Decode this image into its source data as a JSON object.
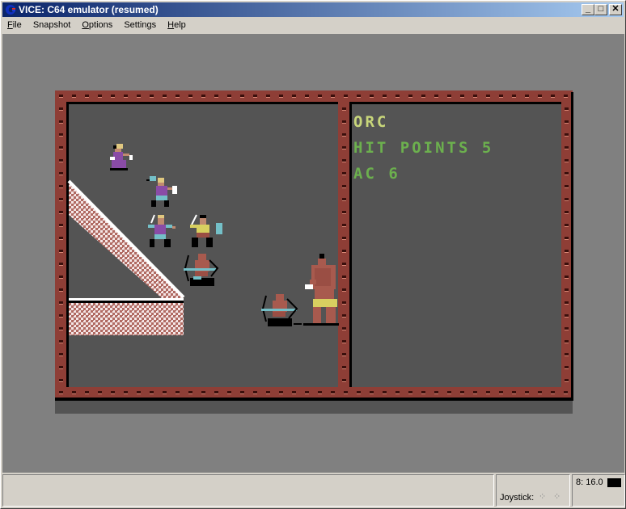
{
  "window": {
    "title": "VICE: C64 emulator (resumed)",
    "icon": "c64-app-icon",
    "controls": [
      {
        "name": "minimize",
        "glyph": "_"
      },
      {
        "name": "maximize",
        "glyph": "□"
      },
      {
        "name": "close",
        "glyph": "✕"
      }
    ]
  },
  "menubar": {
    "items": [
      {
        "label": "File",
        "accel": "F",
        "rest": "ile"
      },
      {
        "label": "Snapshot",
        "accel": "",
        "rest": "Snapshot"
      },
      {
        "label": "Options",
        "accel": "O",
        "rest": "ptions"
      },
      {
        "label": "Settings",
        "accel": "",
        "rest": "Settings"
      },
      {
        "label": "Help",
        "accel": "H",
        "rest": "elp"
      }
    ]
  },
  "game": {
    "info_panel": {
      "name": "ORC",
      "hit_points_label": "HIT POINTS",
      "hit_points_value": "5",
      "ac_label": "AC",
      "ac_value": "6"
    },
    "colors": {
      "screen_bg": "#545454",
      "border": "#8e3e36",
      "name_color": "#c8d67a",
      "stat_color": "#6cb04e",
      "wall_light": "#f4e6e6",
      "wall_dark": "#b06a62"
    },
    "party": [
      {
        "id": "cleric",
        "colors": [
          "#e0c880",
          "#8a4ca6",
          "#ffffff"
        ]
      },
      {
        "id": "fighter-with-flail",
        "colors": [
          "#e0c880",
          "#8a4ca6",
          "#74c0c8"
        ]
      },
      {
        "id": "fighter-purple",
        "colors": [
          "#e0c880",
          "#8a4ca6",
          "#74c0c8"
        ]
      },
      {
        "id": "fighter-yellow-shield",
        "colors": [
          "#d8d060",
          "#74c0c8",
          "#9a4e44"
        ]
      },
      {
        "id": "archer-party",
        "colors": [
          "#a85a4e",
          "#74c0c8"
        ]
      }
    ],
    "enemies": [
      {
        "id": "orc-archer",
        "colors": [
          "#a85a4e",
          "#74c0c8"
        ]
      },
      {
        "id": "orc-chief",
        "colors": [
          "#a85a4e",
          "#d8d060",
          "#ffffff"
        ]
      }
    ]
  },
  "statusbar": {
    "joystick_label": "Joystick:",
    "speed": "8: 16.0"
  }
}
